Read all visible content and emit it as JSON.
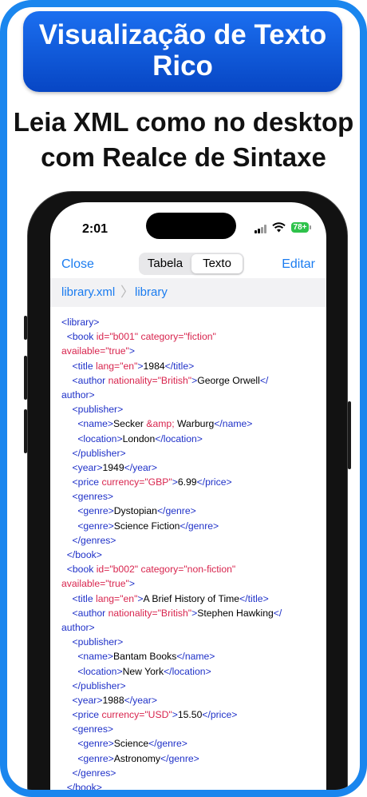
{
  "promo": {
    "banner_line1": "Visualização de Texto",
    "banner_line2": "Rico",
    "headline_line1": "Leia XML como no desktop",
    "headline_line2": "com Realce de Sintaxe"
  },
  "status_bar": {
    "time": "2:01",
    "battery": "78+"
  },
  "navbar": {
    "close_label": "Close",
    "tab_table_label": "Tabela",
    "tab_text_label": "Texto",
    "edit_label": "Editar",
    "selected_tab": "Texto"
  },
  "breadcrumb": {
    "file": "library.xml",
    "separator": "〉",
    "root": "library"
  },
  "colors": {
    "tag": "#1f31c8",
    "attribute": "#d8254e",
    "value": "#d8254e",
    "accent": "#1a7cf0",
    "frame": "#1a86ee"
  },
  "code_lines": [
    [
      [
        "t",
        "<library>"
      ]
    ],
    [
      [
        "t",
        "  <book "
      ],
      [
        "a",
        "id="
      ],
      [
        "v",
        "\"b001\""
      ],
      [
        "a",
        " category="
      ],
      [
        "v",
        "\"fiction\""
      ]
    ],
    [
      [
        "a",
        "available="
      ],
      [
        "v",
        "\"true\""
      ],
      [
        "t",
        ">"
      ]
    ],
    [
      [
        "t",
        "    <title "
      ],
      [
        "a",
        "lang="
      ],
      [
        "v",
        "\"en\""
      ],
      [
        "t",
        ">"
      ],
      [
        "x",
        "1984"
      ],
      [
        "t",
        "</title>"
      ]
    ],
    [
      [
        "t",
        "    <author "
      ],
      [
        "a",
        "nationality="
      ],
      [
        "v",
        "\"British\""
      ],
      [
        "t",
        ">"
      ],
      [
        "x",
        "George Orwell"
      ],
      [
        "t",
        "</"
      ]
    ],
    [
      [
        "t",
        "author>"
      ]
    ],
    [
      [
        "t",
        "    <publisher>"
      ]
    ],
    [
      [
        "t",
        "      <name>"
      ],
      [
        "x",
        "Secker "
      ],
      [
        "v",
        "&amp;"
      ],
      [
        "x",
        " Warburg"
      ],
      [
        "t",
        "</name>"
      ]
    ],
    [
      [
        "t",
        "      <location>"
      ],
      [
        "x",
        "London"
      ],
      [
        "t",
        "</location>"
      ]
    ],
    [
      [
        "t",
        "    </publisher>"
      ]
    ],
    [
      [
        "t",
        "    <year>"
      ],
      [
        "x",
        "1949"
      ],
      [
        "t",
        "</year>"
      ]
    ],
    [
      [
        "t",
        "    <price "
      ],
      [
        "a",
        "currency="
      ],
      [
        "v",
        "\"GBP\""
      ],
      [
        "t",
        ">"
      ],
      [
        "x",
        "6.99"
      ],
      [
        "t",
        "</price>"
      ]
    ],
    [
      [
        "t",
        "    <genres>"
      ]
    ],
    [
      [
        "t",
        "      <genre>"
      ],
      [
        "x",
        "Dystopian"
      ],
      [
        "t",
        "</genre>"
      ]
    ],
    [
      [
        "t",
        "      <genre>"
      ],
      [
        "x",
        "Science Fiction"
      ],
      [
        "t",
        "</genre>"
      ]
    ],
    [
      [
        "t",
        "    </genres>"
      ]
    ],
    [
      [
        "t",
        "  </book>"
      ]
    ],
    [
      [
        "t",
        "  <book "
      ],
      [
        "a",
        "id="
      ],
      [
        "v",
        "\"b002\""
      ],
      [
        "a",
        " category="
      ],
      [
        "v",
        "\"non-fiction\""
      ]
    ],
    [
      [
        "a",
        "available="
      ],
      [
        "v",
        "\"true\""
      ],
      [
        "t",
        ">"
      ]
    ],
    [
      [
        "t",
        "    <title "
      ],
      [
        "a",
        "lang="
      ],
      [
        "v",
        "\"en\""
      ],
      [
        "t",
        ">"
      ],
      [
        "x",
        "A Brief History of Time"
      ],
      [
        "t",
        "</title>"
      ]
    ],
    [
      [
        "t",
        "    <author "
      ],
      [
        "a",
        "nationality="
      ],
      [
        "v",
        "\"British\""
      ],
      [
        "t",
        ">"
      ],
      [
        "x",
        "Stephen Hawking"
      ],
      [
        "t",
        "</"
      ]
    ],
    [
      [
        "t",
        "author>"
      ]
    ],
    [
      [
        "t",
        "    <publisher>"
      ]
    ],
    [
      [
        "t",
        "      <name>"
      ],
      [
        "x",
        "Bantam Books"
      ],
      [
        "t",
        "</name>"
      ]
    ],
    [
      [
        "t",
        "      <location>"
      ],
      [
        "x",
        "New York"
      ],
      [
        "t",
        "</location>"
      ]
    ],
    [
      [
        "t",
        "    </publisher>"
      ]
    ],
    [
      [
        "t",
        "    <year>"
      ],
      [
        "x",
        "1988"
      ],
      [
        "t",
        "</year>"
      ]
    ],
    [
      [
        "t",
        "    <price "
      ],
      [
        "a",
        "currency="
      ],
      [
        "v",
        "\"USD\""
      ],
      [
        "t",
        ">"
      ],
      [
        "x",
        "15.50"
      ],
      [
        "t",
        "</price>"
      ]
    ],
    [
      [
        "t",
        "    <genres>"
      ]
    ],
    [
      [
        "t",
        "      <genre>"
      ],
      [
        "x",
        "Science"
      ],
      [
        "t",
        "</genre>"
      ]
    ],
    [
      [
        "t",
        "      <genre>"
      ],
      [
        "x",
        "Astronomy"
      ],
      [
        "t",
        "</genre>"
      ]
    ],
    [
      [
        "t",
        "    </genres>"
      ]
    ],
    [
      [
        "t",
        "  </book>"
      ]
    ]
  ]
}
